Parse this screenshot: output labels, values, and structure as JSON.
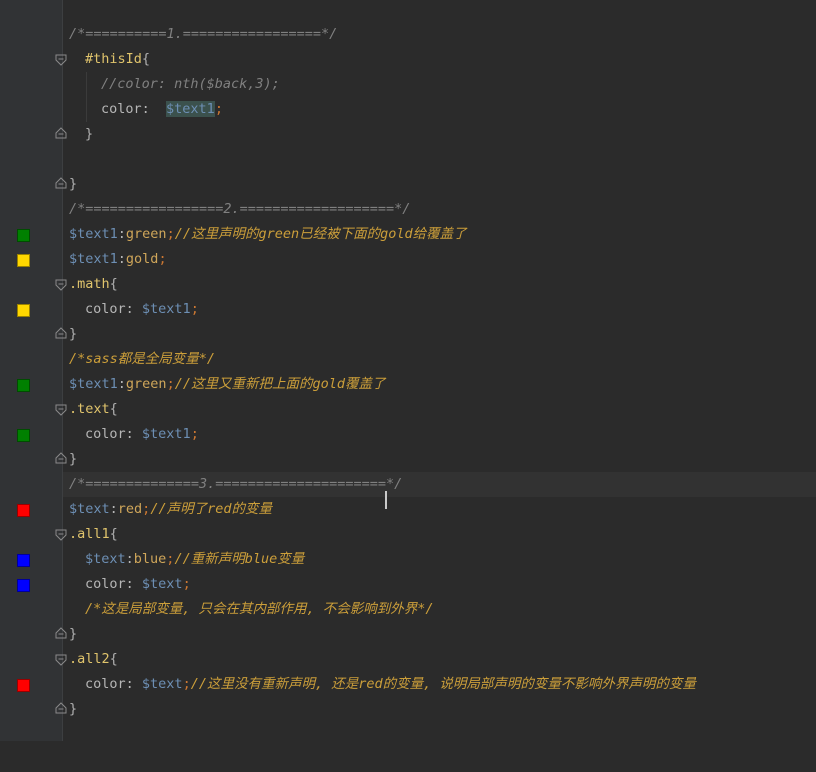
{
  "colors": {
    "background": "#2b2b2b",
    "gutter": "#313335",
    "comment": "#808080",
    "variable": "#6d8fb4",
    "selector": "#e0c46c",
    "value": "#cfa65a",
    "swatch_green": "#008000",
    "swatch_gold": "#ffd700",
    "swatch_red": "#ff0000",
    "swatch_blue": "#0000ff"
  },
  "lines": [
    {
      "id": 1,
      "text": "/*==========1.=================*/"
    },
    {
      "id": 2,
      "selector": "#thisId",
      "brace": "{"
    },
    {
      "id": 3,
      "text": "//color: nth($back,3);"
    },
    {
      "id": 4,
      "prop": "color:",
      "value": "$text1",
      "end": ";"
    },
    {
      "id": 5,
      "text": "}"
    },
    {
      "id": 6,
      "text": "}"
    },
    {
      "id": 7,
      "text": "/*=================2.===================*/"
    },
    {
      "id": 8,
      "var": "$text1",
      "colon": ":",
      "value": "green",
      "end": ";",
      "comment_prefix": "//这里声明的",
      "comment_kw1": "green",
      "comment_mid": "已经被下面的",
      "comment_kw2": "gold",
      "comment_suffix": "给覆盖了"
    },
    {
      "id": 9,
      "var": "$text1",
      "colon": ":",
      "value": "gold",
      "end": ";"
    },
    {
      "id": 10,
      "selector": ".math",
      "brace": "{"
    },
    {
      "id": 11,
      "prop": "color:",
      "value": "$text1",
      "end": ";"
    },
    {
      "id": 12,
      "text": "}"
    },
    {
      "id": 13,
      "comment_prefix": "/*",
      "comment_kw1": "sass",
      "comment_suffix": "都是全局变量*/"
    },
    {
      "id": 14,
      "var": "$text1",
      "colon": ":",
      "value": "green",
      "end": ";",
      "comment_prefix": "//这里又重新把上面的",
      "comment_kw1": "gold",
      "comment_suffix": "覆盖了"
    },
    {
      "id": 15,
      "selector": ".text",
      "brace": "{"
    },
    {
      "id": 16,
      "prop": "color:",
      "value": "$text1",
      "end": ";"
    },
    {
      "id": 17,
      "text": "}"
    },
    {
      "id": 18,
      "text_a": "/*==============3.=====================",
      "text_b": "*/"
    },
    {
      "id": 19,
      "var": "$text",
      "colon": ":",
      "value": "red",
      "end": ";",
      "comment_prefix": "//声明了",
      "comment_kw1": "red",
      "comment_suffix": "的变量"
    },
    {
      "id": 20,
      "selector": ".all1",
      "brace": "{"
    },
    {
      "id": 21,
      "var": "$text",
      "colon": ":",
      "value": "blue",
      "end": ";",
      "comment_prefix": "//重新声明",
      "comment_kw1": "blue",
      "comment_suffix": "变量"
    },
    {
      "id": 22,
      "prop": "color:",
      "value": "$text",
      "end": ";"
    },
    {
      "id": 23,
      "text": "/*这是局部变量, 只会在其内部作用, 不会影响到外界*/"
    },
    {
      "id": 24,
      "text": "}"
    },
    {
      "id": 25,
      "selector": ".all2",
      "brace": "{"
    },
    {
      "id": 26,
      "prop": "color:",
      "value": "$text",
      "end": ";",
      "comment_prefix": "//这里没有重新声明, 还是",
      "comment_kw1": "red",
      "comment_suffix": "的变量, 说明局部声明的变量不影响外界声明的变量"
    },
    {
      "id": 27,
      "text": "}"
    }
  ]
}
